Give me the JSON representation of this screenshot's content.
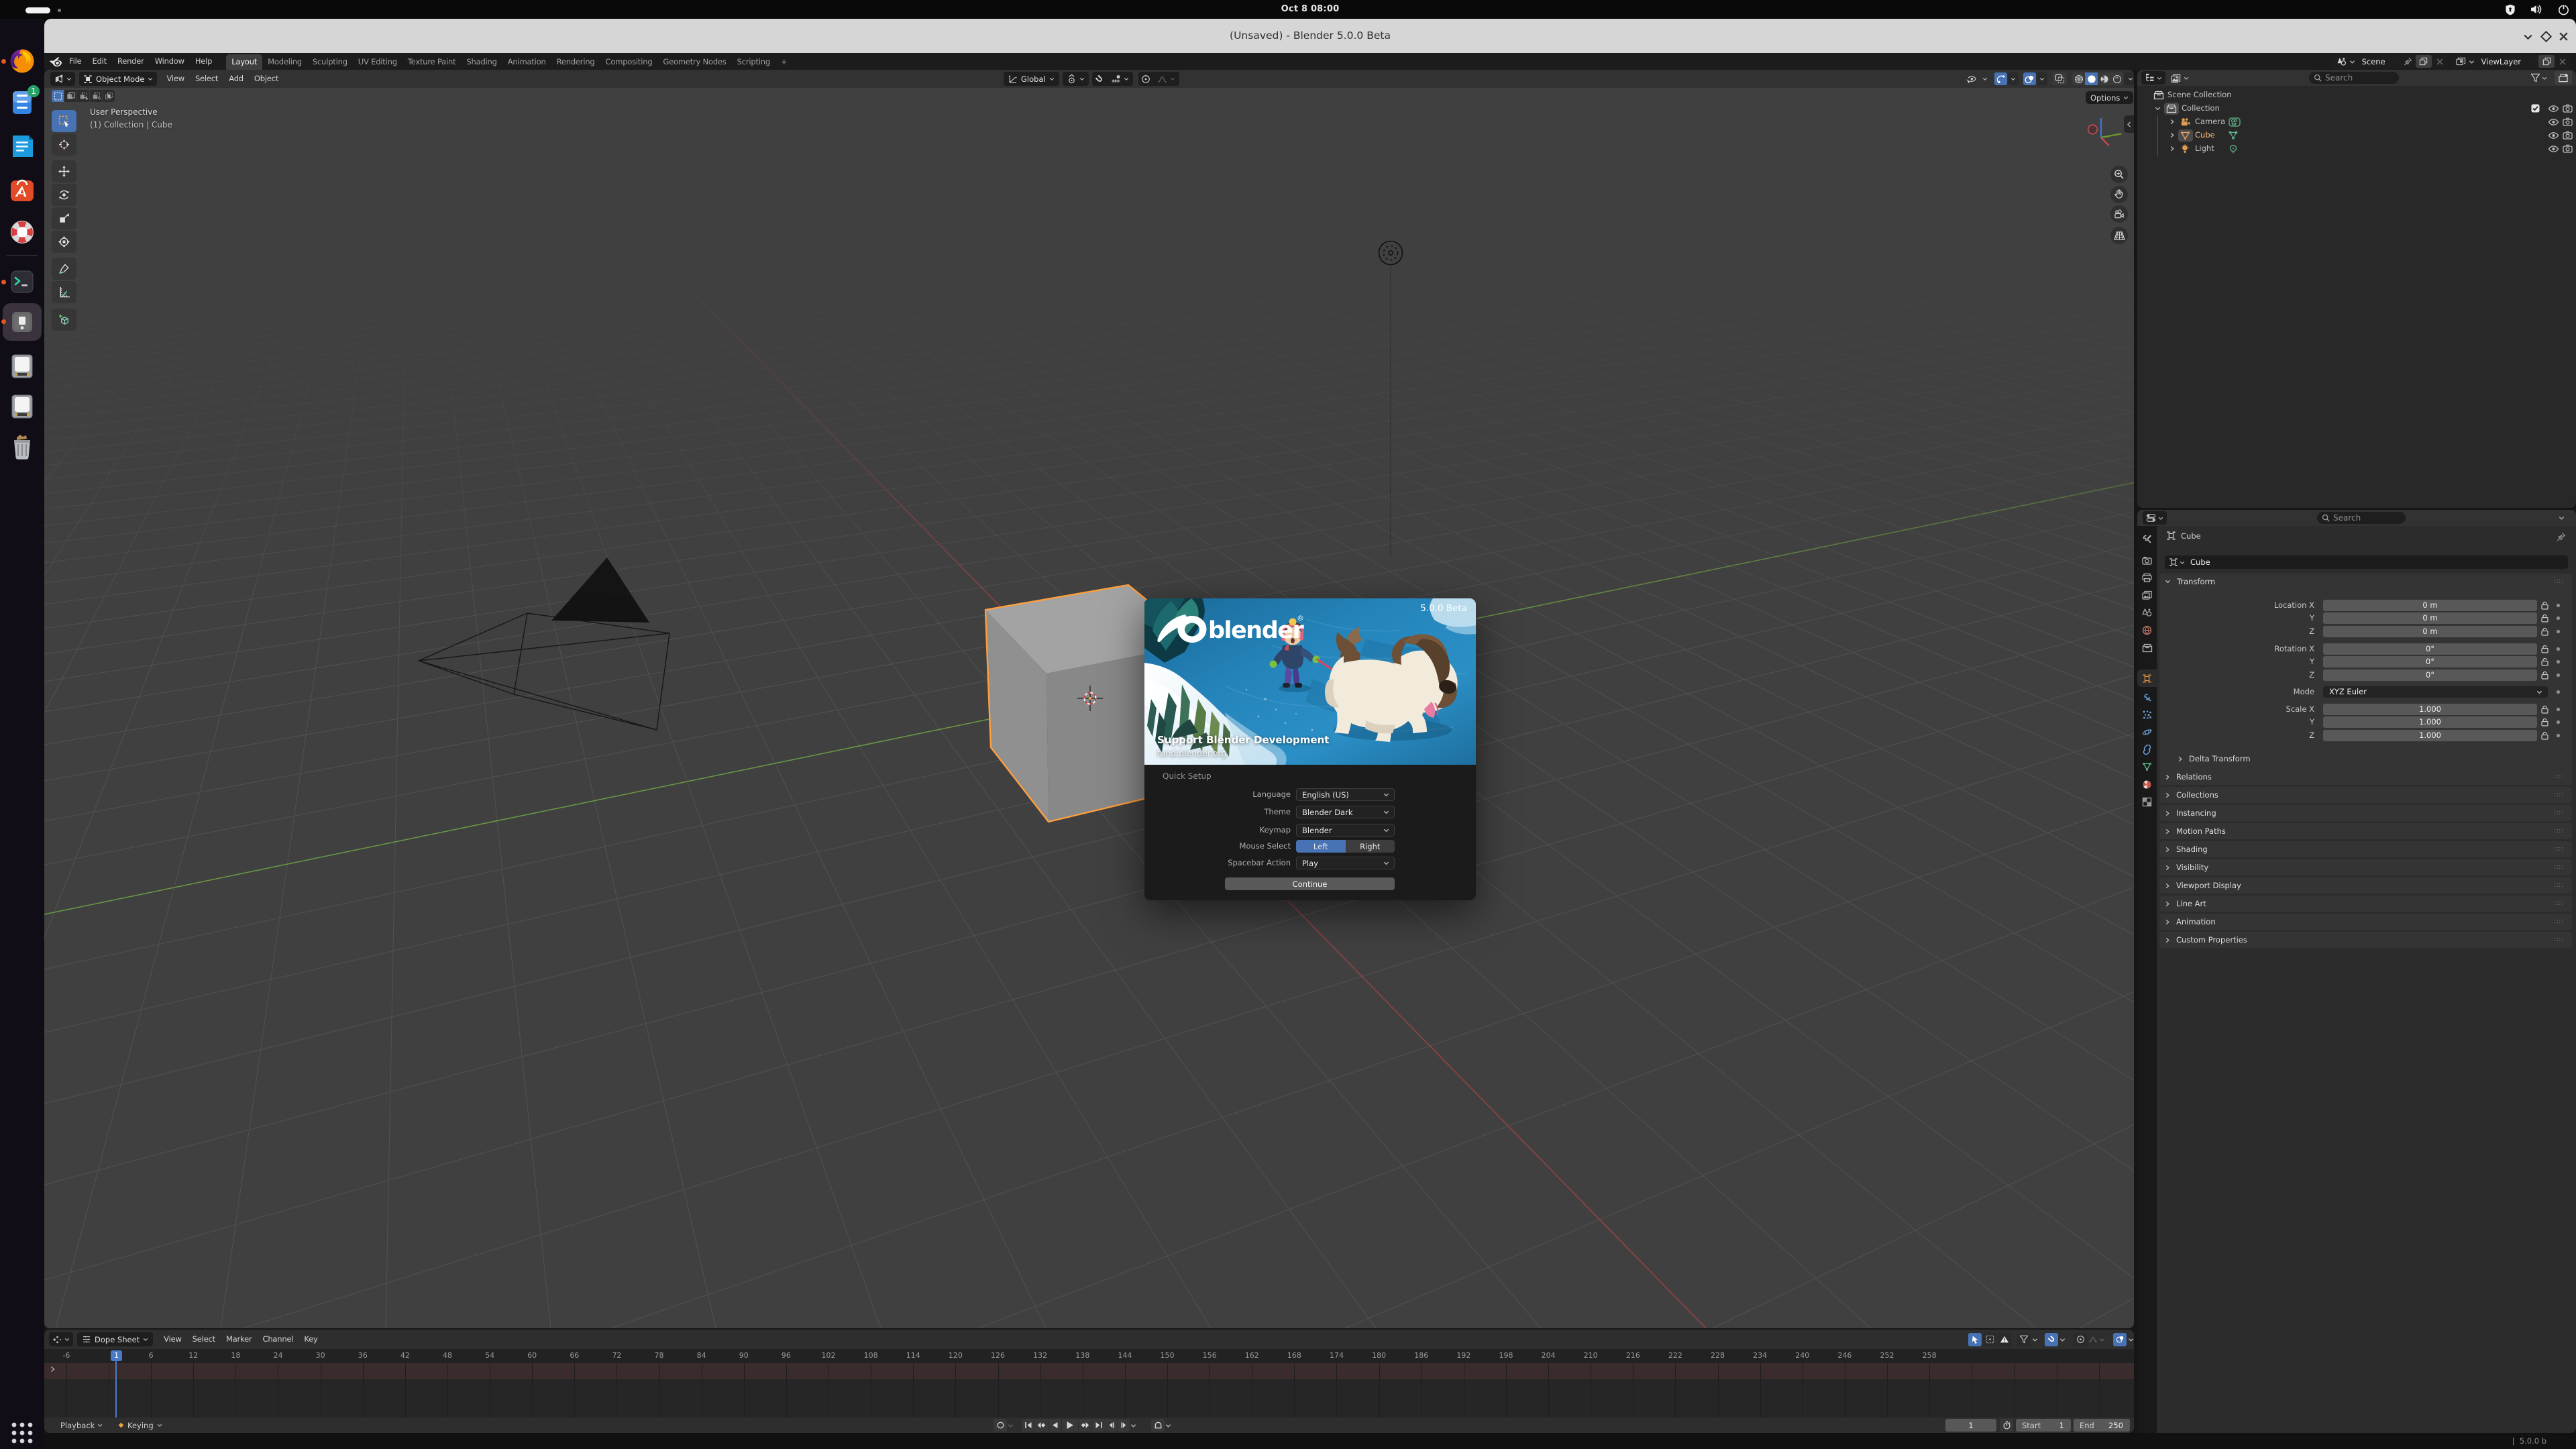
{
  "system": {
    "clock": "Oct 8  08:00",
    "tray_icons": [
      "privacy-shield",
      "volume",
      "power"
    ]
  },
  "titlebar": {
    "title": "(Unsaved) - Blender 5.0.0 Beta"
  },
  "dock": {
    "items": [
      {
        "name": "firefox",
        "running": true
      },
      {
        "name": "files",
        "badge": "1"
      },
      {
        "name": "text-editor"
      },
      {
        "name": "software-store"
      },
      {
        "name": "help"
      },
      {
        "name": "terminal",
        "running": true
      },
      {
        "name": "blender-window",
        "running": true,
        "active": true
      },
      {
        "name": "disk-1"
      },
      {
        "name": "disk-2"
      },
      {
        "name": "trash"
      },
      {
        "name": "show-apps"
      }
    ]
  },
  "topbar": {
    "menus": [
      "File",
      "Edit",
      "Render",
      "Window",
      "Help"
    ],
    "tabs": [
      "Layout",
      "Modeling",
      "Sculpting",
      "UV Editing",
      "Texture Paint",
      "Shading",
      "Animation",
      "Rendering",
      "Compositing",
      "Geometry Nodes",
      "Scripting"
    ],
    "active_tab": "Layout",
    "add_tab": "+",
    "scene_selector": {
      "label": "Scene"
    },
    "viewlayer_selector": {
      "label": "ViewLayer"
    }
  },
  "viewport": {
    "header": {
      "mode": "Object Mode",
      "menus": [
        "View",
        "Select",
        "Add",
        "Object"
      ],
      "orientation": "Global",
      "options_label": "Options"
    },
    "overlay_text": {
      "line1": "User Perspective",
      "line2": "(1) Collection | Cube"
    },
    "gizmo_axes": [
      "X",
      "Y",
      "Z"
    ]
  },
  "outliner": {
    "search_placeholder": "Search",
    "rows": [
      {
        "label": "Scene Collection",
        "level": 0,
        "icon": "collection"
      },
      {
        "label": "Collection",
        "level": 1,
        "icon": "collection",
        "expanded": true,
        "controls": [
          "checkbox",
          "eye",
          "camera"
        ]
      },
      {
        "label": "Camera",
        "level": 2,
        "icon": "camera-object",
        "badge": "camera-data",
        "controls": [
          "eye",
          "camera"
        ]
      },
      {
        "label": "Cube",
        "level": 2,
        "icon": "mesh-object",
        "badge": "mesh-data",
        "selected": true,
        "controls": [
          "eye",
          "camera"
        ]
      },
      {
        "label": "Light",
        "level": 2,
        "icon": "light-object",
        "badge": "light-data",
        "controls": [
          "eye",
          "camera"
        ]
      }
    ]
  },
  "properties": {
    "search_placeholder": "Search",
    "breadcrumb": "Cube",
    "name_value": "Cube",
    "transform_title": "Transform",
    "rows": [
      {
        "label": "Location X",
        "value": "0 m"
      },
      {
        "label": "Y",
        "value": "0 m"
      },
      {
        "label": "Z",
        "value": "0 m"
      },
      {
        "label": "Rotation X",
        "value": "0°"
      },
      {
        "label": "Y",
        "value": "0°"
      },
      {
        "label": "Z",
        "value": "0°"
      },
      {
        "label": "Mode",
        "value": "XYZ Euler",
        "type": "select"
      },
      {
        "label": "Scale X",
        "value": "1.000"
      },
      {
        "label": "Y",
        "value": "1.000"
      },
      {
        "label": "Z",
        "value": "1.000"
      }
    ],
    "subpanel": "Delta Transform",
    "panels": [
      "Relations",
      "Collections",
      "Instancing",
      "Motion Paths",
      "Shading",
      "Visibility",
      "Viewport Display",
      "Line Art",
      "Animation",
      "Custom Properties"
    ]
  },
  "timeline": {
    "editor": "Dope Sheet",
    "menus": [
      "View",
      "Select",
      "Marker",
      "Channel",
      "Key"
    ],
    "ruler": {
      "first": -6,
      "last": 258,
      "step": 6
    },
    "current_frame": "1",
    "playback_label": "Playback",
    "keying_label": "Keying",
    "frame_field": "1",
    "start_label": "Start",
    "start_value": "1",
    "end_label": "End",
    "end_value": "250"
  },
  "statusbar": {
    "version": "5.0.0 b"
  },
  "splash": {
    "version": "5.0.0 Beta",
    "brand": "blender",
    "support_title": "Support Blender Development",
    "support_url": "fund.blender.org",
    "section": "Quick Setup",
    "rows": [
      {
        "label": "Language",
        "value": "English (US)",
        "type": "select"
      },
      {
        "label": "Theme",
        "value": "Blender Dark",
        "type": "select"
      },
      {
        "label": "Keymap",
        "value": "Blender",
        "type": "select",
        "gap_before": true
      },
      {
        "label": "Mouse Select",
        "type": "buttons",
        "options": [
          "Left",
          "Right"
        ],
        "active": "Left"
      },
      {
        "label": "Spacebar Action",
        "value": "Play",
        "type": "select"
      }
    ],
    "continue_label": "Continue"
  },
  "colors": {
    "accent": "#4772b3",
    "selection_outline": "#ff9f3d",
    "axis_x": "#9e4242",
    "axis_y": "#6d9e42",
    "viewport_bg": "#3d3d3d"
  }
}
